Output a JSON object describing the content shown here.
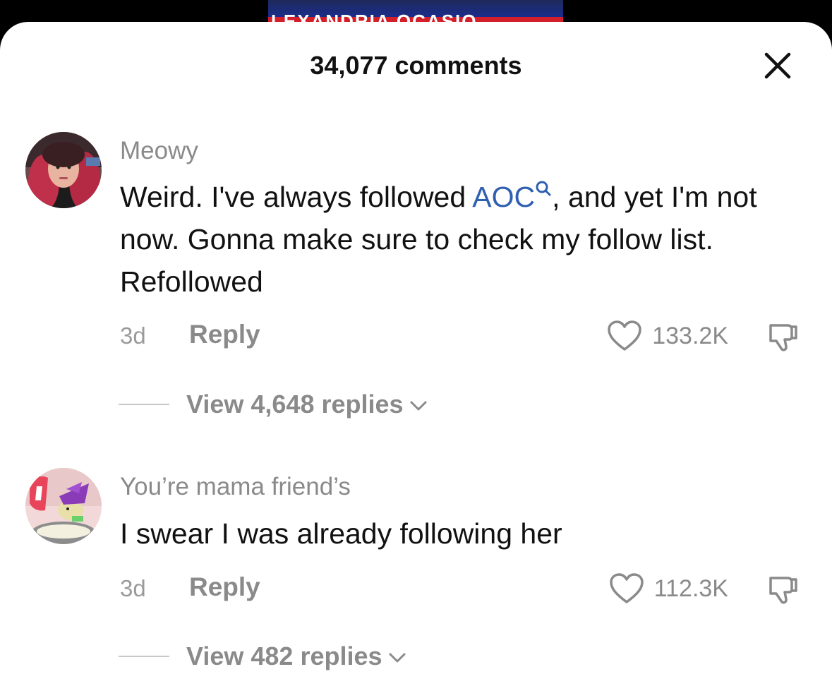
{
  "video": {
    "banner_text": "LEXANDRIA OCASIO"
  },
  "header": {
    "title": "34,077 comments",
    "close_icon": "close-icon"
  },
  "comments": [
    {
      "username": "Meowy",
      "text_before": "Weird. I've always followed ",
      "mention": "AOC",
      "text_after": ", and yet I'm not now. Gonna make sure to check my follow list. Refollowed",
      "time": "3d",
      "reply_label": "Reply",
      "likes": "133.2K",
      "view_replies": "View 4,648 replies"
    },
    {
      "username": "You’re mama friend’s",
      "text": "I swear I was already following her",
      "time": "3d",
      "reply_label": "Reply",
      "likes": "112.3K",
      "view_replies": "View 482 replies"
    }
  ],
  "colors": {
    "mention": "#2f5fb0",
    "muted": "#8a8a8a",
    "text": "#111111"
  }
}
